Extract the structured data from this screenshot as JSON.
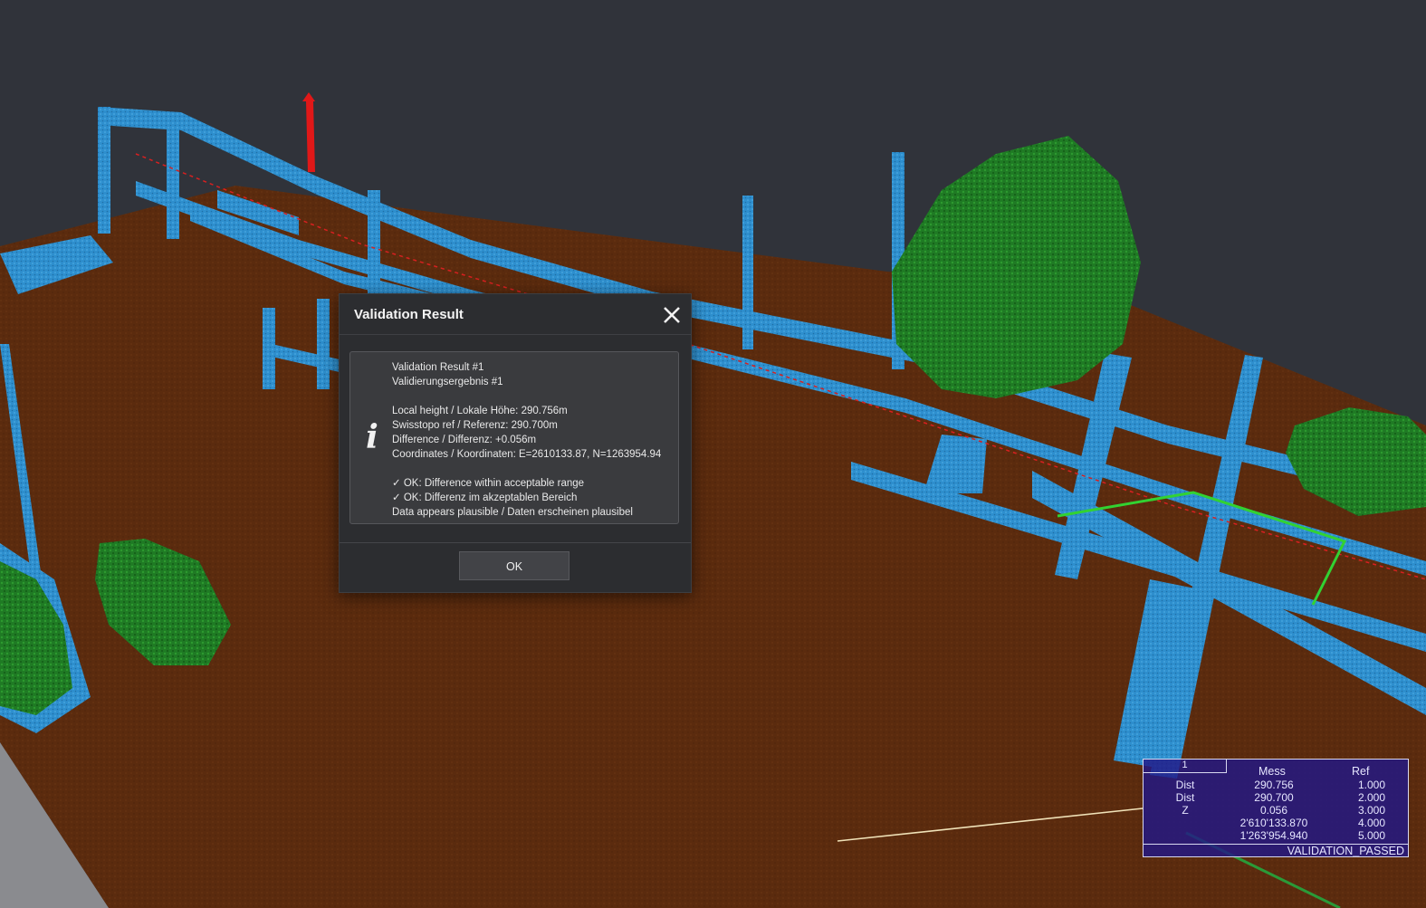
{
  "scene": {
    "colors": {
      "background": "#30333a",
      "ground": "#5a2a0d",
      "structures": "#2e8fce",
      "vegetation": "#1e7a23",
      "marker": "#e01818",
      "measure_line": "#32d232"
    }
  },
  "dialog": {
    "title": "Validation Result",
    "close_icon": "close-icon",
    "info_icon": "info-icon",
    "info_glyph": "i",
    "lines": {
      "result_en": "Validation Result #1",
      "result_de": "Validierungsergebnis #1",
      "local_height": "Local height / Lokale Höhe: 290.756m",
      "swisstopo_ref": "Swisstopo ref / Referenz: 290.700m",
      "difference": "Difference / Differenz: +0.056m",
      "coordinates": "Coordinates / Koordinaten: E=2610133.87, N=1263954.94",
      "ok_en": "✓ OK: Difference within acceptable range",
      "ok_de": "✓ OK: Differenz im akzeptablen Bereich",
      "plausible": "Data appears plausible / Daten erscheinen plausibel"
    },
    "ok_label": "OK"
  },
  "measurement": {
    "tab": "1",
    "headers": {
      "mess": "Mess",
      "ref": "Ref"
    },
    "rows": [
      {
        "label": "Dist",
        "mess": "290.756",
        "ref": "1.000"
      },
      {
        "label": "Dist",
        "mess": "290.700",
        "ref": "2.000"
      },
      {
        "label": "Z",
        "mess": "0.056",
        "ref": "3.000"
      },
      {
        "label": "",
        "mess": "2'610'133.870",
        "ref": "4.000"
      },
      {
        "label": "",
        "mess": "1'263'954.940",
        "ref": "5.000"
      }
    ],
    "status": "VALIDATION_PASSED"
  }
}
